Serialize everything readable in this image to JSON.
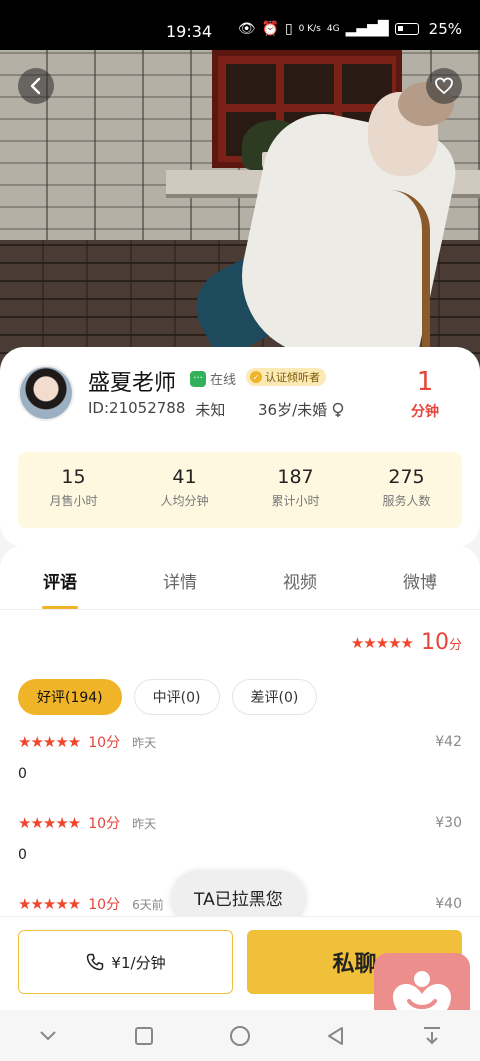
{
  "status": {
    "time": "19:34",
    "net_speed": "0 K/s",
    "signal_label": "4G",
    "battery": "25%"
  },
  "profile": {
    "name": "盛夏老师",
    "online": "在线",
    "verified": "认证倾听者",
    "id": "ID:21052788",
    "location": "未知",
    "age_marital": "36岁/未婚",
    "price_value": "1",
    "price_unit": "分钟"
  },
  "stats": [
    {
      "value": "15",
      "label": "月售小时"
    },
    {
      "value": "41",
      "label": "人均分钟"
    },
    {
      "value": "187",
      "label": "累计小时"
    },
    {
      "value": "275",
      "label": "服务人数"
    }
  ],
  "tabs": [
    {
      "label": "评语"
    },
    {
      "label": "详情"
    },
    {
      "label": "视频"
    },
    {
      "label": "微博"
    }
  ],
  "rating": {
    "stars": "★★★★★",
    "score": "10",
    "unit": "分"
  },
  "filters": [
    {
      "label": "好评(194)"
    },
    {
      "label": "中评(0)"
    },
    {
      "label": "差评(0)"
    }
  ],
  "reviews": [
    {
      "stars": "★★★★★",
      "score": "10分",
      "date": "昨天",
      "amount": "¥42",
      "text": "0"
    },
    {
      "stars": "★★★★★",
      "score": "10分",
      "date": "昨天",
      "amount": "¥30",
      "text": "0"
    },
    {
      "stars": "★★★★★",
      "score": "10分",
      "date": "6天前",
      "amount": "¥40",
      "text": ""
    }
  ],
  "toast": "TA已拉黑您",
  "bottom": {
    "call_label": "¥1/分钟",
    "chat_label": "私聊"
  },
  "colors": {
    "accent": "#f0c03a",
    "price_red": "#e5453a",
    "star": "#f0462e",
    "stats_bg": "#fff8e1"
  }
}
